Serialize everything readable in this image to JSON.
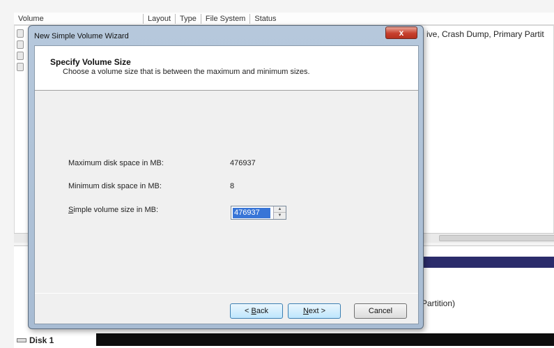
{
  "background": {
    "columns": [
      "Volume",
      "Layout",
      "Type",
      "File System",
      "Status"
    ],
    "status_text": "ive, Crash Dump, Primary Partit",
    "partition_text": "Partition)",
    "disk_label": "Disk 1"
  },
  "wizard": {
    "title": "New Simple Volume Wizard",
    "close_glyph": "x",
    "heading": "Specify Volume Size",
    "subheading": "Choose a volume size that is between the maximum and minimum sizes.",
    "fields": [
      {
        "label": "Maximum disk space in MB:",
        "value": "476937"
      },
      {
        "label": "Minimum disk space in MB:",
        "value": "8"
      }
    ],
    "size_label": "Simple volume size in MB:",
    "size_label_access": "S",
    "size_label_rest": "imple volume size in MB:",
    "size_value": "476937",
    "buttons": {
      "back_access": "B",
      "back_pre": "< ",
      "back_rest": "ack",
      "next_access": "N",
      "next_rest": "ext >",
      "cancel": "Cancel"
    }
  },
  "colors": {
    "selection": "#3875d7",
    "close_button": "#c7402d",
    "navy_bar": "#2b2c6b"
  }
}
